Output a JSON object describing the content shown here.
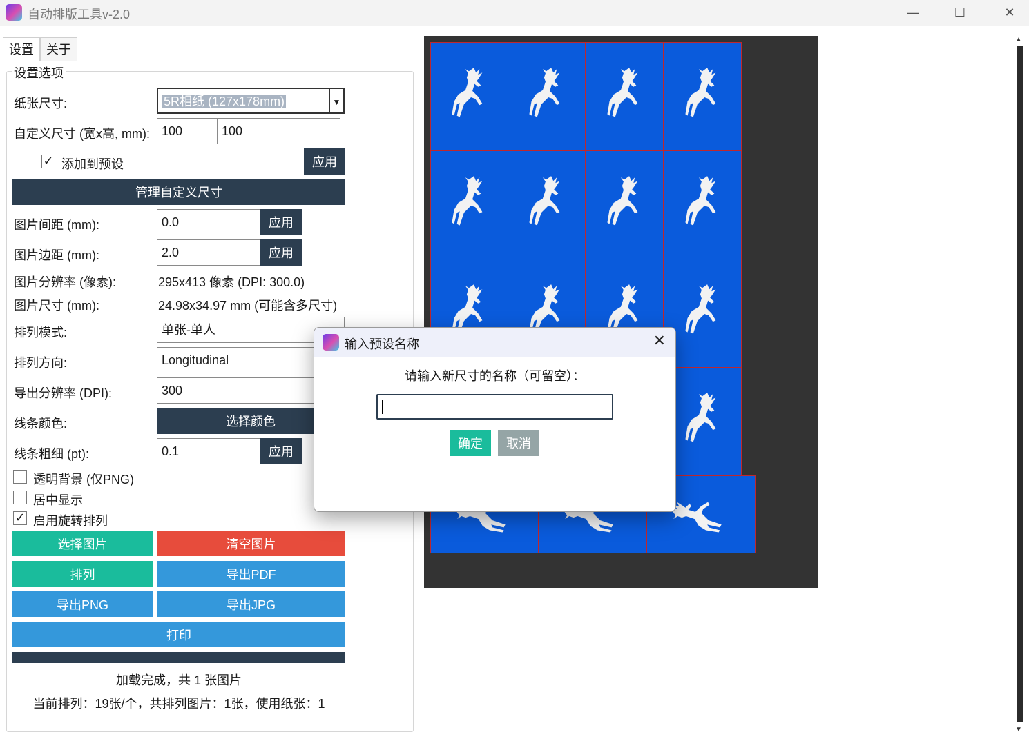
{
  "window": {
    "title": "自动排版工具v-2.0",
    "min": "—",
    "max": "☐",
    "close": "✕"
  },
  "tabs": [
    {
      "label": "设置"
    },
    {
      "label": "关于"
    }
  ],
  "settings": {
    "group_title": "设置选项",
    "paper_size": {
      "label": "纸张尺寸:",
      "value": "5R相纸 (127x178mm)"
    },
    "custom_size": {
      "label": "自定义尺寸 (宽x高, mm):",
      "width": "100",
      "height": "100"
    },
    "add_preset": {
      "label": "添加到预设",
      "checked": true,
      "apply": "应用"
    },
    "manage_custom": "管理自定义尺寸",
    "spacing": {
      "label": "图片间距 (mm):",
      "value": "0.0",
      "apply": "应用"
    },
    "margin": {
      "label": "图片边距 (mm):",
      "value": "2.0",
      "apply": "应用"
    },
    "resolution": {
      "label": "图片分辨率 (像素):",
      "value": "295x413 像素 (DPI: 300.0)"
    },
    "img_size": {
      "label": "图片尺寸 (mm):",
      "value": "24.98x34.97 mm (可能含多尺寸)"
    },
    "layout_mode": {
      "label": "排列模式:",
      "value": "单张-单人"
    },
    "direction": {
      "label": "排列方向:",
      "value": "Longitudinal"
    },
    "export_dpi": {
      "label": "导出分辨率 (DPI):",
      "value": "300"
    },
    "line_color": {
      "label": "线条颜色:",
      "button": "选择颜色"
    },
    "line_width": {
      "label": "线条粗细 (pt):",
      "value": "0.1",
      "apply": "应用"
    },
    "transparent": {
      "label": "透明背景 (仅PNG)",
      "checked": false
    },
    "center": {
      "label": "居中显示",
      "checked": false
    },
    "rotate": {
      "label": "启用旋转排列",
      "checked": true
    }
  },
  "actions": {
    "select_images": "选择图片",
    "clear_images": "清空图片",
    "arrange": "排列",
    "export_pdf": "导出PDF",
    "export_png": "导出PNG",
    "export_jpg": "导出JPG",
    "print": "打印"
  },
  "status": {
    "loaded": "加载完成，共 1 张图片",
    "current": "当前排列：19张/个，共排列图片：1张，使用纸张：1"
  },
  "dialog": {
    "title": "输入预设名称",
    "prompt": "请输入新尺寸的名称（可留空）：",
    "input_value": "",
    "ok": "确定",
    "cancel": "取消",
    "close": "✕"
  },
  "colors": {
    "accent_dark": "#2c3e50",
    "teal": "#1abc9c",
    "red": "#e74c3c",
    "blue": "#3498db",
    "tile_blue": "#0a5bdc",
    "tile_border": "#c0272d"
  },
  "icons": [
    "app-icon",
    "deer-icon",
    "check-icon",
    "dropdown-arrow-icon",
    "close-icon"
  ]
}
